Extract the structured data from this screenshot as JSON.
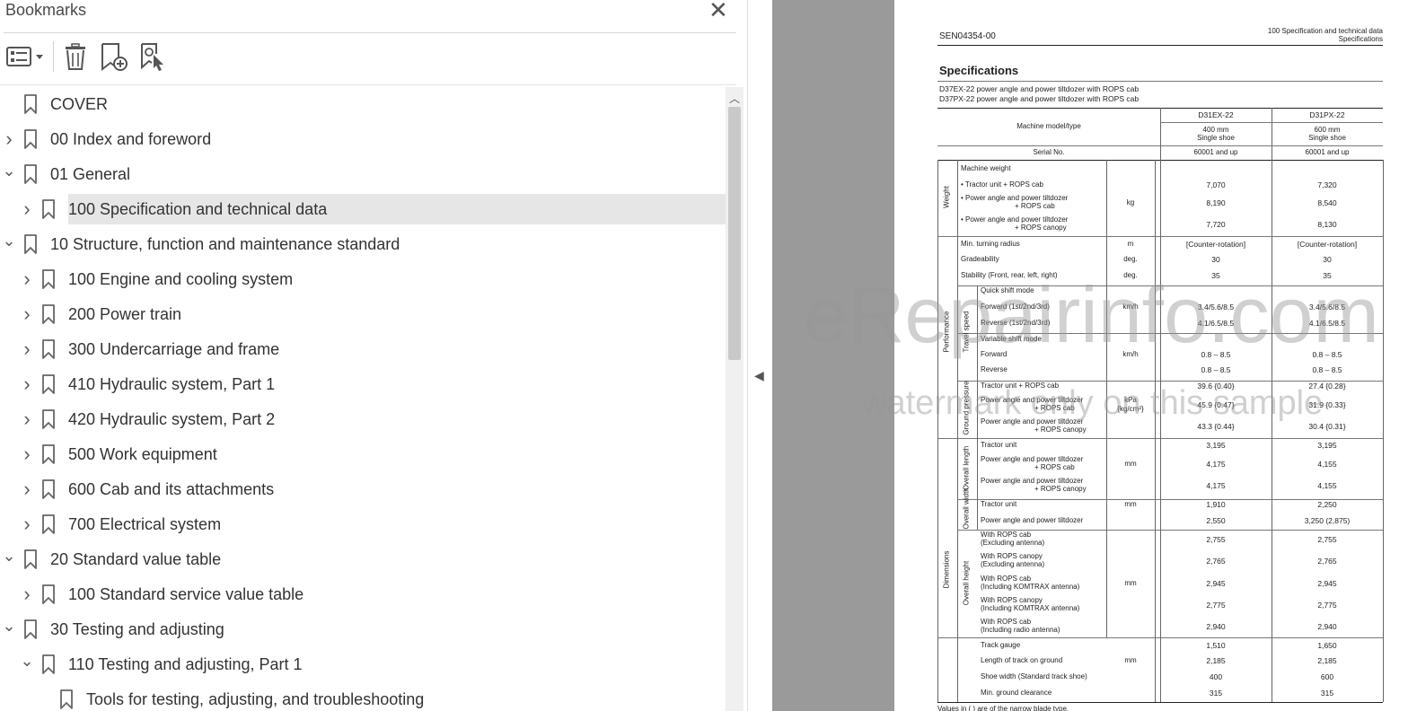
{
  "panel": {
    "title": "Bookmarks",
    "close_glyph": "✕",
    "toolbar": [
      {
        "icon": "options-list-icon"
      },
      {
        "icon": "delete-bookmark-icon"
      },
      {
        "icon": "new-bookmark-icon"
      },
      {
        "icon": "new-bookmark-from-structure-icon"
      }
    ]
  },
  "bookmarks": [
    {
      "level": 0,
      "toggle": "",
      "label": "COVER"
    },
    {
      "level": 0,
      "toggle": "›",
      "label": "00 Index and foreword"
    },
    {
      "level": 0,
      "toggle": "⌄",
      "label": "01 General"
    },
    {
      "level": 1,
      "toggle": "›",
      "label": "100 Specification and technical data",
      "selected": true
    },
    {
      "level": 0,
      "toggle": "⌄",
      "label": "10 Structure, function and maintenance standard"
    },
    {
      "level": 1,
      "toggle": "›",
      "label": "100 Engine and cooling system"
    },
    {
      "level": 1,
      "toggle": "›",
      "label": "200 Power train"
    },
    {
      "level": 1,
      "toggle": "›",
      "label": "300 Undercarriage and frame"
    },
    {
      "level": 1,
      "toggle": "›",
      "label": "410 Hydraulic system, Part 1"
    },
    {
      "level": 1,
      "toggle": "›",
      "label": "420 Hydraulic system, Part 2"
    },
    {
      "level": 1,
      "toggle": "›",
      "label": "500 Work equipment"
    },
    {
      "level": 1,
      "toggle": "›",
      "label": "600 Cab and its attachments"
    },
    {
      "level": 1,
      "toggle": "›",
      "label": "700 Electrical system"
    },
    {
      "level": 0,
      "toggle": "⌄",
      "label": "20 Standard value table"
    },
    {
      "level": 1,
      "toggle": "›",
      "label": "100 Standard service value table"
    },
    {
      "level": 0,
      "toggle": "⌄",
      "label": "30 Testing and adjusting"
    },
    {
      "level": 1,
      "toggle": "⌄",
      "label": "110 Testing and adjusting, Part 1"
    },
    {
      "level": 2,
      "toggle": "",
      "label": "Tools for testing, adjusting, and troubleshooting"
    }
  ],
  "doc": {
    "doc_no": "SEN04354-00",
    "header_r1": "100 Specification and technical data",
    "header_r2": "Specifications",
    "heading": "Specifications",
    "sub1": "D37EX-22 power angle and power tiltdozer with ROPS cab",
    "sub2": "D37PX-22 power angle and power tiltdozer with ROPS cab",
    "machine_model": "Machine model/type",
    "model1": "D31EX-22",
    "model2": "D31PX-22",
    "shoe1a": "400 mm",
    "shoe1b": "Single shoe",
    "shoe2a": "600 mm",
    "shoe2b": "Single shoe",
    "serial": "Serial No.",
    "serial1": "60001 and up",
    "serial2": "60001 and up",
    "cat_weight": "Weight",
    "cat_performance": "Performance",
    "cat_travel": "Travel speed",
    "cat_ground": "Ground pressure",
    "cat_dimensions": "Dimensions",
    "cat_overall_length": "Overall length",
    "cat_overall_width": "Overall width",
    "cat_overall_height": "Overall height",
    "footnote": "Values in ( ) are of the narrow blade type.",
    "rows": [
      {
        "t": "Machine weight",
        "u": "",
        "a": "",
        "b": ""
      },
      {
        "t": "• Tractor unit + ROPS cab",
        "u": "",
        "a": "7,070",
        "b": "7,320"
      },
      {
        "t": "• Power angle and power tiltdozer",
        "t2": "+ ROPS cab",
        "u": "kg",
        "a": "8,190",
        "b": "8,540"
      },
      {
        "t": "• Power angle and power tiltdozer",
        "t2": "+ ROPS canopy",
        "u": "",
        "a": "7,720",
        "b": "8,130"
      },
      {
        "t": "Min. turning radius",
        "u": "m",
        "a": "[Counter-rotation]",
        "b": "[Counter-rotation]"
      },
      {
        "t": "Gradeability",
        "u": "deg.",
        "a": "30",
        "b": "30"
      },
      {
        "t": "Stability (Front, rear, left, right)",
        "u": "deg.",
        "a": "35",
        "b": "35"
      },
      {
        "t": "Quick shift mode",
        "u": "",
        "a": "",
        "b": ""
      },
      {
        "t": "Forward (1st/2nd/3rd)",
        "u": "km/h",
        "a": "3.4/5.6/8.5",
        "b": "3.4/5.6/8.5"
      },
      {
        "t": "Reverse (1st/2nd/3rd)",
        "u": "",
        "a": "4.1/6.5/8.5",
        "b": "4.1/6.5/8.5"
      },
      {
        "t": "Variable shift mode",
        "u": "",
        "a": "",
        "b": ""
      },
      {
        "t": "Forward",
        "u": "km/h",
        "a": "0.8 – 8.5",
        "b": "0.8 – 8.5"
      },
      {
        "t": "Reverse",
        "u": "",
        "a": "0.8 – 8.5",
        "b": "0.8 – 8.5"
      },
      {
        "t": "Tractor unit + ROPS cab",
        "u": "",
        "a": "39.6 {0.40}",
        "b": "27.4 {0.28}"
      },
      {
        "t": "Power angle and power tiltdozer",
        "t2": "+ ROPS cab",
        "u": "kPa",
        "u2": "{kg/cm²}",
        "a": "45.9 {0.47}",
        "b": "31.9 {0.33}"
      },
      {
        "t": "Power angle and power tiltdozer",
        "t2": "+ ROPS canopy",
        "u": "",
        "a": "43.3 {0.44}",
        "b": "30.4 {0.31}"
      },
      {
        "t": "Tractor unit",
        "u": "",
        "a": "3,195",
        "b": "3,195"
      },
      {
        "t": "Power angle and power tiltdozer",
        "t2": "+ ROPS cab",
        "u": "mm",
        "a": "4,175",
        "b": "4,155"
      },
      {
        "t": "Power angle and power tiltdozer",
        "t2": "+ ROPS canopy",
        "u": "",
        "a": "4,175",
        "b": "4,155"
      },
      {
        "t": "Tractor unit",
        "u": "mm",
        "a": "1,910",
        "b": "2,250"
      },
      {
        "t": "Power angle and power tiltdozer",
        "u": "",
        "a": "2,550",
        "b": "3,250 (2,875)"
      },
      {
        "t": "With ROPS cab",
        "t2": "(Excluding antenna)",
        "u": "",
        "a": "2,755",
        "b": "2,755"
      },
      {
        "t": "With ROPS canopy",
        "t2": "(Excluding antenna)",
        "u": "",
        "a": "2,765",
        "b": "2,765"
      },
      {
        "t": "With ROPS cab",
        "t2": "(Including KOMTRAX antenna)",
        "u": "mm",
        "a": "2,945",
        "b": "2,945"
      },
      {
        "t": "With ROPS canopy",
        "t2": "(Including KOMTRAX antenna)",
        "u": "",
        "a": "2,775",
        "b": "2,775"
      },
      {
        "t": "With ROPS cab",
        "t2": "(Including radio antenna)",
        "u": "",
        "a": "2,940",
        "b": "2,940"
      },
      {
        "t": "Track gauge",
        "u": "",
        "a": "1,510",
        "b": "1,650"
      },
      {
        "t": "Length of track on ground",
        "u": "mm",
        "a": "2,185",
        "b": "2,185"
      },
      {
        "t": "Shoe width (Standard track shoe)",
        "u": "",
        "a": "400",
        "b": "600"
      },
      {
        "t": "Min. ground clearance",
        "u": "",
        "a": "315",
        "b": "315"
      }
    ]
  },
  "watermark": {
    "line1": "eRepairinfo.com",
    "line2": "watermark only on this sample"
  }
}
